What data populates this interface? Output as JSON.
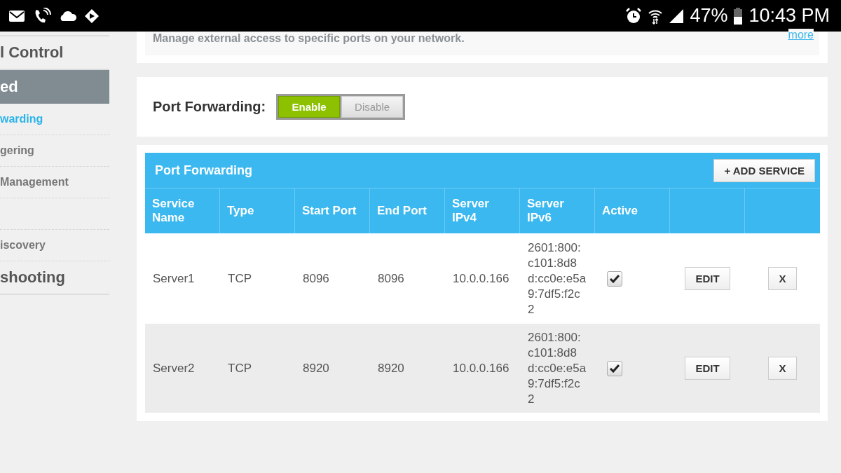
{
  "status_bar": {
    "battery_text": "47%",
    "time": "10:43 PM"
  },
  "sidebar": {
    "items": [
      {
        "label": "l Control",
        "kind": "section",
        "selected": false
      },
      {
        "label": "ed",
        "kind": "section",
        "selected": true
      },
      {
        "label": "warding",
        "kind": "link",
        "selected": true
      },
      {
        "label": "gering",
        "kind": "link",
        "selected": false
      },
      {
        "label": "Management",
        "kind": "link",
        "selected": false
      },
      {
        "kind": "blank"
      },
      {
        "label": "iscovery",
        "kind": "link",
        "selected": false
      },
      {
        "label": "shooting",
        "kind": "section",
        "selected": false
      }
    ]
  },
  "intro": {
    "text": "Manage external access to specific ports on your network.",
    "link": "more"
  },
  "toggle": {
    "label": "Port Forwarding:",
    "options": [
      {
        "label": "Enable",
        "selected": true
      },
      {
        "label": "Disable",
        "selected": false
      }
    ]
  },
  "table": {
    "title": "Port Forwarding",
    "add_button": "+ ADD SERVICE",
    "columns": [
      "Service Name",
      "Type",
      "Start Port",
      "End Port",
      "Server IPv4",
      "Server IPv6",
      "Active"
    ],
    "rows": [
      {
        "service_name": "Server1",
        "type": "TCP",
        "start_port": "8096",
        "end_port": "8096",
        "server_ipv4": "10.0.0.166",
        "server_ipv6": "2601:800:c101:8d8d:cc0e:e5a9:7df5:f2c2",
        "active": true,
        "edit": "EDIT",
        "delete": "X"
      },
      {
        "service_name": "Server2",
        "type": "TCP",
        "start_port": "8920",
        "end_port": "8920",
        "server_ipv4": "10.0.0.166",
        "server_ipv6": "2601:800:c101:8d8d:cc0e:e5a9:7df5:f2c2",
        "active": true,
        "edit": "EDIT",
        "delete": "X"
      }
    ]
  }
}
